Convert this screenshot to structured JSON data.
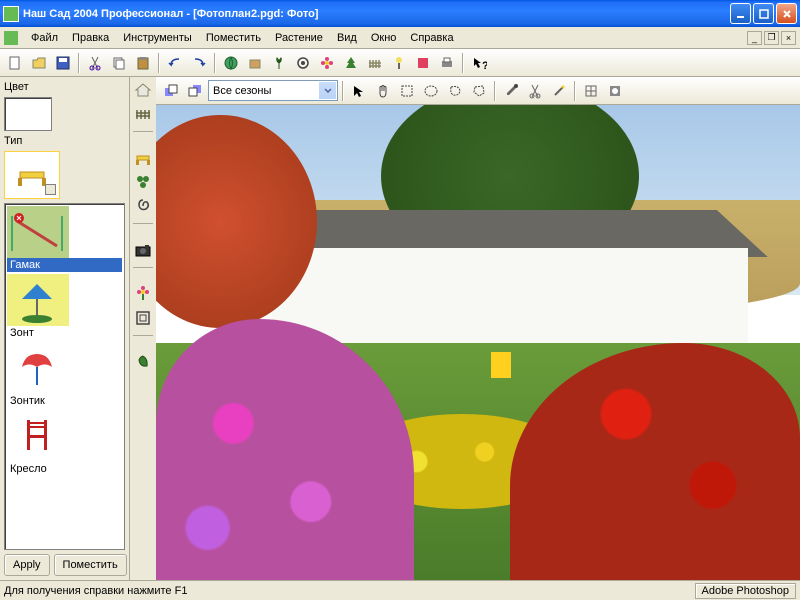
{
  "window": {
    "title": "Наш Сад 2004 Профессионал - [Фотоплан2.pgd: Фото]"
  },
  "menu": {
    "file": "Файл",
    "edit": "Правка",
    "tools": "Инструменты",
    "place": "Поместить",
    "plant": "Растение",
    "view": "Вид",
    "window": "Окно",
    "help": "Справка"
  },
  "panel": {
    "color_label": "Цвет",
    "type_label": "Тип"
  },
  "catalog": {
    "items": [
      {
        "label": "Гамак"
      },
      {
        "label": "Зонт"
      },
      {
        "label": "Зонтик"
      },
      {
        "label": "Кресло"
      }
    ]
  },
  "buttons": {
    "apply": "Apply",
    "place": "Поместить"
  },
  "canvas_toolbar": {
    "season": "Все сезоны"
  },
  "status": {
    "help": "Для получения справки нажмите F1",
    "tray": "Adobe Photoshop"
  }
}
